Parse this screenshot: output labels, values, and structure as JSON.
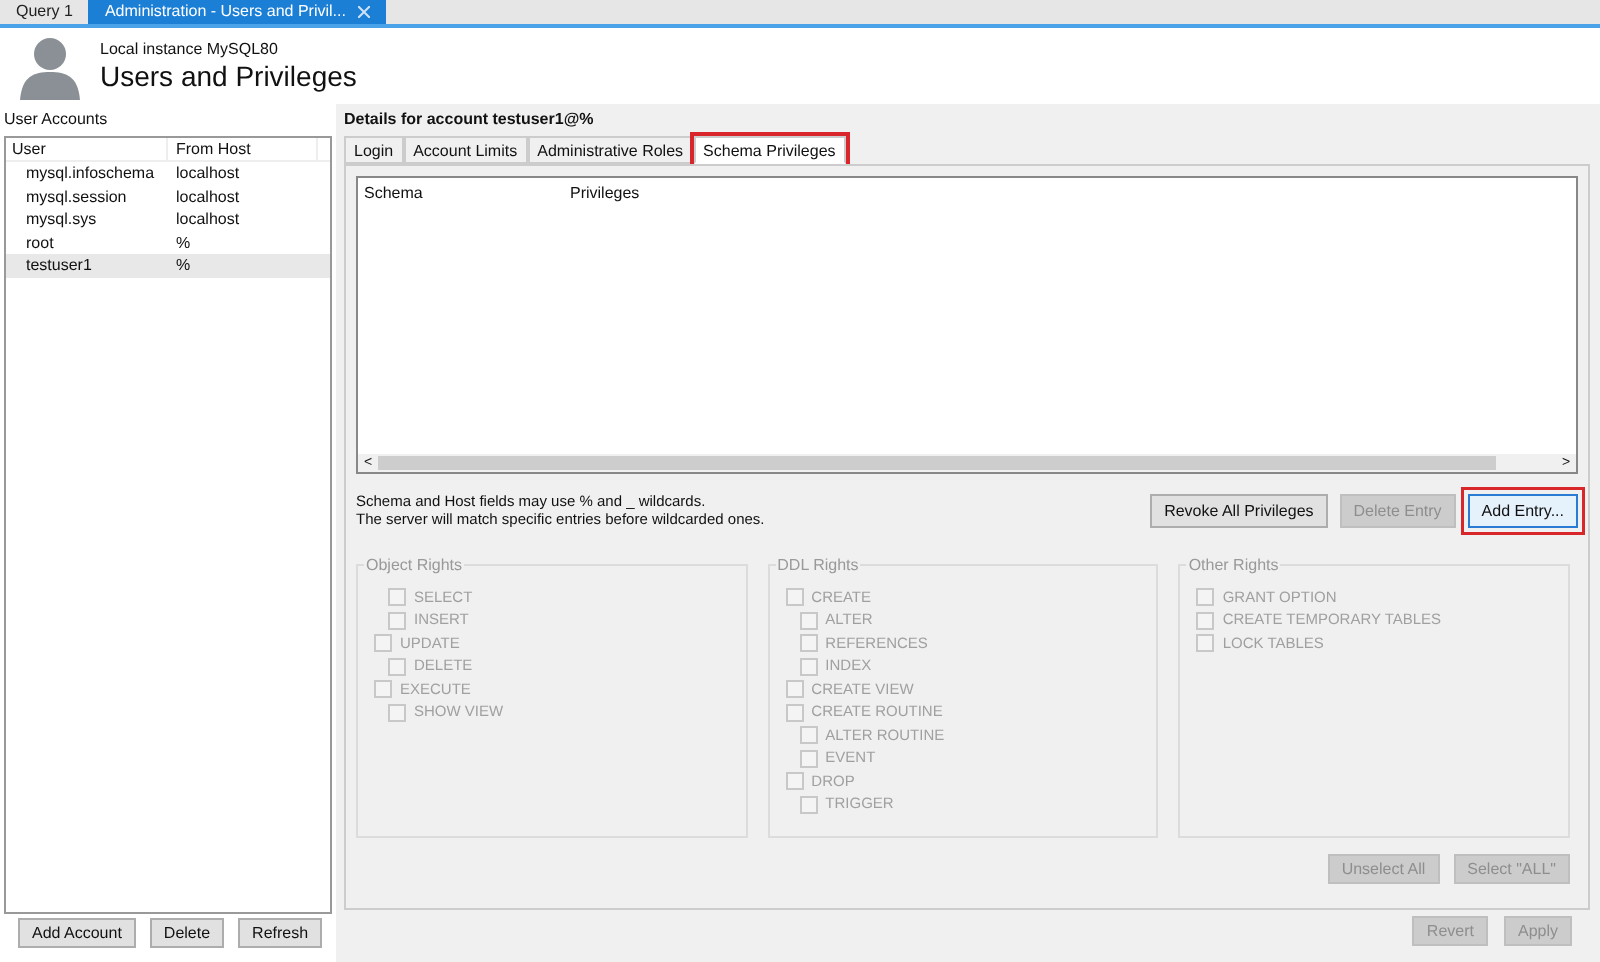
{
  "doc_tabs": [
    {
      "label": "Query 1",
      "selected": false,
      "closable": false
    },
    {
      "label": "Administration - Users and Privil...",
      "selected": true,
      "closable": true
    }
  ],
  "header": {
    "subtitle": "Local instance MySQL80",
    "title": "Users and Privileges"
  },
  "user_accounts": {
    "label": "User Accounts",
    "columns": [
      "User",
      "From Host"
    ],
    "rows": [
      {
        "user": "mysql.infoschema",
        "host": "localhost",
        "selected": false
      },
      {
        "user": "mysql.session",
        "host": "localhost",
        "selected": false
      },
      {
        "user": "mysql.sys",
        "host": "localhost",
        "selected": false
      },
      {
        "user": "root",
        "host": "%",
        "selected": false
      },
      {
        "user": "testuser1",
        "host": "%",
        "selected": true
      }
    ],
    "buttons": [
      "Add Account",
      "Delete",
      "Refresh"
    ]
  },
  "details": {
    "title": "Details for account testuser1@%",
    "tabs": [
      {
        "label": "Login",
        "selected": false,
        "highlighted": false
      },
      {
        "label": "Account Limits",
        "selected": false,
        "highlighted": false
      },
      {
        "label": "Administrative Roles",
        "selected": false,
        "highlighted": false
      },
      {
        "label": "Schema Privileges",
        "selected": true,
        "highlighted": true
      }
    ],
    "table_columns": [
      "Schema",
      "Privileges"
    ],
    "scroll_left": "<",
    "scroll_right": ">",
    "hint_lines": [
      "Schema and Host fields may use % and _ wildcards.",
      "The server will match specific entries before wildcarded ones."
    ],
    "entry_buttons": [
      {
        "label": "Revoke All Privileges",
        "disabled": false,
        "highlighted": false
      },
      {
        "label": "Delete Entry",
        "disabled": true,
        "highlighted": false
      },
      {
        "label": "Add Entry...",
        "disabled": false,
        "highlighted": true
      }
    ],
    "groups": [
      {
        "title": "Object Rights",
        "items": [
          {
            "label": "SELECT",
            "kind": "sub",
            "checked": false
          },
          {
            "label": "INSERT",
            "kind": "sub",
            "checked": false
          },
          {
            "label": "UPDATE",
            "kind": "main",
            "checked": false
          },
          {
            "label": "DELETE",
            "kind": "sub",
            "checked": false
          },
          {
            "label": "EXECUTE",
            "kind": "main",
            "checked": false
          },
          {
            "label": "SHOW VIEW",
            "kind": "sub",
            "checked": false
          }
        ]
      },
      {
        "title": "DDL Rights",
        "items": [
          {
            "label": "CREATE",
            "kind": "main",
            "checked": false
          },
          {
            "label": "ALTER",
            "kind": "sub",
            "checked": false
          },
          {
            "label": "REFERENCES",
            "kind": "sub",
            "checked": false
          },
          {
            "label": "INDEX",
            "kind": "sub",
            "checked": false
          },
          {
            "label": "CREATE VIEW",
            "kind": "main",
            "checked": false
          },
          {
            "label": "CREATE ROUTINE",
            "kind": "main",
            "checked": false
          },
          {
            "label": "ALTER ROUTINE",
            "kind": "sub",
            "checked": false
          },
          {
            "label": "EVENT",
            "kind": "sub",
            "checked": false
          },
          {
            "label": "DROP",
            "kind": "main",
            "checked": false
          },
          {
            "label": "TRIGGER",
            "kind": "sub",
            "checked": false
          }
        ]
      },
      {
        "title": "Other Rights",
        "items": [
          {
            "label": "GRANT OPTION",
            "kind": "main",
            "checked": false
          },
          {
            "label": "CREATE TEMPORARY TABLES",
            "kind": "main",
            "checked": false
          },
          {
            "label": "LOCK TABLES",
            "kind": "main",
            "checked": false
          }
        ]
      }
    ],
    "select_buttons": [
      {
        "label": "Unselect All",
        "disabled": true
      },
      {
        "label": "Select \"ALL\"",
        "disabled": true
      }
    ]
  },
  "footer_buttons": [
    {
      "label": "Revert",
      "disabled": true
    },
    {
      "label": "Apply",
      "disabled": true
    }
  ]
}
